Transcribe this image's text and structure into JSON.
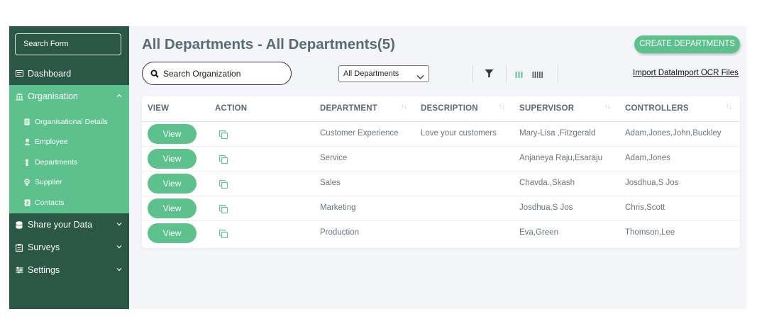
{
  "sidebar": {
    "search_label": "Search Form",
    "dashboard": "Dashboard",
    "organisation": "Organisation",
    "sub_items": [
      "Organisational Details",
      "Employee",
      "Departments",
      "Supplier",
      "Contacts"
    ],
    "share_data": "Share your Data",
    "surveys": "Surveys",
    "settings": "Settings"
  },
  "header": {
    "title": "All Departments - All Departments(5)",
    "create_button": "CREATE DEPARTMENTS",
    "search_placeholder": "Search Organization",
    "department_select": "All Departments",
    "import_link": "Import DataImport OCR Files"
  },
  "table": {
    "columns": [
      "VIEW",
      "ACTION",
      "DEPARTMENT",
      "DESCRIPTION",
      "SUPERVISOR",
      "CONTROLLERS"
    ],
    "view_label": "View",
    "rows": [
      {
        "department": "Customer Experience",
        "description": "Love your customers",
        "supervisor": "Mary-Lisa ,Fitzgerald",
        "controllers": "Adam,Jones,John,Buckley"
      },
      {
        "department": "Service",
        "description": "",
        "supervisor": "Anjaneya Raju,Esaraju",
        "controllers": "Adam,Jones"
      },
      {
        "department": "Sales",
        "description": "",
        "supervisor": "Chavda.,Skash",
        "controllers": "Josdhua,S Jos"
      },
      {
        "department": "Marketing",
        "description": "",
        "supervisor": "Josdhua,S Jos",
        "controllers": "Chris,Scott"
      },
      {
        "department": "Production",
        "description": "",
        "supervisor": "Eva,Green",
        "controllers": "Thomson,Lee"
      }
    ]
  },
  "colors": {
    "sidebar_bg": "#2a5746",
    "accent": "#5cc18d",
    "title": "#5c6a73"
  }
}
